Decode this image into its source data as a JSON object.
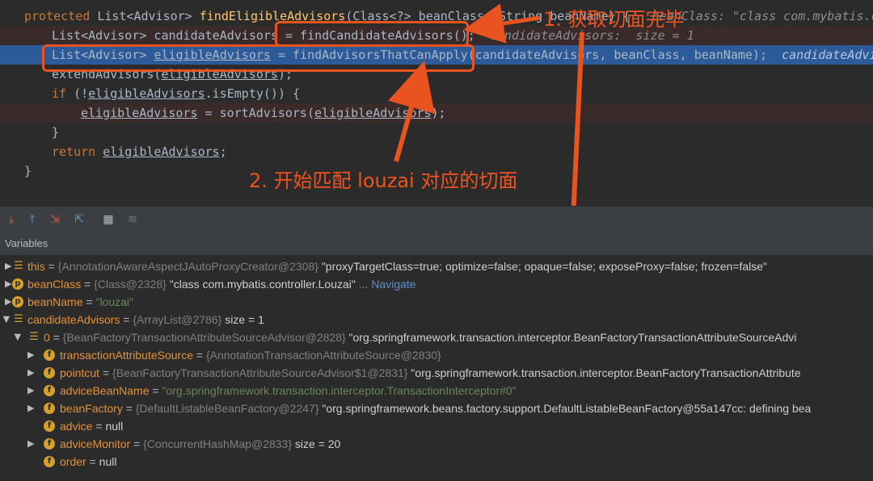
{
  "editor": {
    "lines": [
      {
        "t1": "protected ",
        "t2": "List<Advisor> ",
        "t3": "findEligibleAdvisors",
        "t4": "(Class<?> beanClass, String beanName) {",
        "hint": "   beanClass: \"class com.mybatis.cont"
      },
      {
        "t1": "List<Advisor> candidateAdvisors = ",
        "t2": "findCandidateAdvisors",
        "t3": "();",
        "hint": "  candidateAdvisors:  size = 1"
      },
      {
        "t1": "List<Advisor> ",
        "t2": "eligibleAdvisors",
        "t3": " = findAdvisorsThatCanApply(candidateAdvisors, beanClass, beanName);",
        "hint": "  candidateAdviso"
      },
      {
        "t1": "extendAdvisors(",
        "t2": "eligibleAdvisors",
        "t3": ");"
      },
      {
        "t1": "if ",
        "t2": "(!",
        "t3": "eligibleAdvisors",
        "t4": ".isEmpty()) {"
      },
      {
        "t1": "eligibleAdvisors",
        "t2": " = sortAdvisors(",
        "t3": "eligibleAdvisors",
        "t4": ");"
      },
      {
        "t1": "}"
      },
      {
        "t1": "return ",
        "t2": "eligibleAdvisors",
        "t3": ";"
      },
      {
        "t1": "}"
      }
    ]
  },
  "annotations": {
    "note1": "1. 获取切面完毕",
    "note2": "2. 开始匹配 louzai 对应的切面"
  },
  "toolbar": {
    "icons": [
      "step-over-icon",
      "step-into-icon",
      "force-step-icon",
      "step-out-icon",
      "run-to-cursor-icon",
      "evaluate-icon",
      "trace-icon"
    ]
  },
  "variables": {
    "header": "Variables",
    "rows": [
      {
        "name": "this",
        "eq": " = ",
        "type": "{AnnotationAwareAspectJAutoProxyCreator@2308} ",
        "value": "\"proxyTargetClass=true; optimize=false; opaque=false; exposeProxy=false; frozen=false\""
      },
      {
        "name": "beanClass",
        "eq": " = ",
        "type": "{Class@2328} ",
        "value": "\"class com.mybatis.controller.Louzai\"",
        "link": " ... Navigate"
      },
      {
        "name": "beanName",
        "eq": " = ",
        "value": "\"louzai\""
      },
      {
        "name": "candidateAdvisors",
        "eq": " = ",
        "type": "{ArrayList@2786} ",
        "value": " size = 1"
      },
      {
        "name": "0",
        "eq": " = ",
        "type": "{BeanFactoryTransactionAttributeSourceAdvisor@2828} ",
        "value": "\"org.springframework.transaction.interceptor.BeanFactoryTransactionAttributeSourceAdvi"
      },
      {
        "name": "transactionAttributeSource",
        "eq": " = ",
        "type": "{AnnotationTransactionAttributeSource@2830}"
      },
      {
        "name": "pointcut",
        "eq": " = ",
        "type": "{BeanFactoryTransactionAttributeSourceAdvisor$1@2831} ",
        "value": "\"org.springframework.transaction.interceptor.BeanFactoryTransactionAttribute"
      },
      {
        "name": "adviceBeanName",
        "eq": " = ",
        "value": "\"org.springframework.transaction.interceptor.TransactionInterceptor#0\""
      },
      {
        "name": "beanFactory",
        "eq": " = ",
        "type": "{DefaultListableBeanFactory@2247} ",
        "value": "\"org.springframework.beans.factory.support.DefaultListableBeanFactory@55a147cc: defining bea"
      },
      {
        "name": "advice",
        "eq": " = ",
        "value": "null"
      },
      {
        "name": "adviceMonitor",
        "eq": " = ",
        "type": "{ConcurrentHashMap@2833} ",
        "value": " size = 20"
      },
      {
        "name": "order",
        "eq": " = ",
        "value": "null"
      }
    ]
  },
  "colors": {
    "annotation": "#e8531f",
    "current_line": "#2d5b9a",
    "keyword": "#cc7832",
    "method": "#ffc66d"
  }
}
